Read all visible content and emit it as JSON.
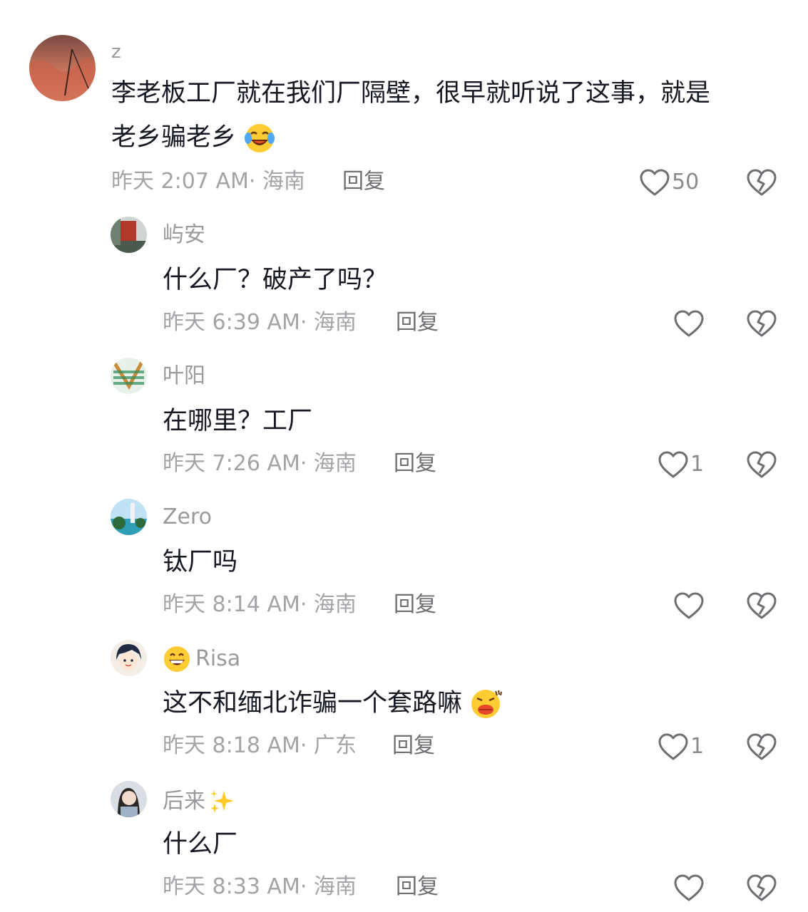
{
  "comments": [
    {
      "username": "z",
      "text_line1": "李老板工厂就在我们厂隔壁，很早就听说了这事，就是",
      "text_line2": "老乡骗老乡",
      "time": "昨天 2:07 AM",
      "location": "· 海南",
      "reply": "回复",
      "likes": "50"
    },
    {
      "username": "屿安",
      "text": "什么厂？破产了吗？",
      "time": "昨天 6:39 AM",
      "location": "· 海南",
      "reply": "回复",
      "likes": ""
    },
    {
      "username": "叶阳",
      "text": "在哪里？工厂",
      "time": "昨天 7:26 AM",
      "location": "· 海南",
      "reply": "回复",
      "likes": "1"
    },
    {
      "username": "Zero",
      "text": "钛厂吗",
      "time": "昨天 8:14 AM",
      "location": "· 海南",
      "reply": "回复",
      "likes": ""
    },
    {
      "username": "Risa",
      "text": "这不和缅北诈骗一个套路嘛",
      "time": "昨天 8:18 AM",
      "location": "· 广东",
      "reply": "回复",
      "likes": "1"
    },
    {
      "username": "后来",
      "text": "什么厂",
      "time": "昨天 8:33 AM",
      "location": "· 海南",
      "reply": "回复",
      "likes": ""
    }
  ],
  "colors": {
    "text": "#161823",
    "username": "#9a9a9e",
    "meta": "#a3a3a8",
    "icon": "#6e6e73"
  },
  "icons": [
    "heart-icon",
    "broken-heart-icon",
    "laugh-cry-emoji",
    "grin-emoji",
    "pouting-lips-emoji",
    "sparkles-emoji"
  ]
}
